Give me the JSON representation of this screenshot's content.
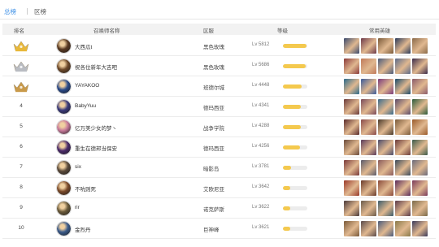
{
  "tabs": [
    {
      "label": "总榜",
      "active": true
    },
    {
      "label": "区榜",
      "active": false
    }
  ],
  "columns": {
    "rank": "排名",
    "name": "召唤师名称",
    "region": "区服",
    "level": "等级",
    "heroes": "常用英雄"
  },
  "colors": {
    "accent": "#3a8ee6",
    "level_bar": "#f4c94e",
    "gold_badge": "#e8b83a",
    "silver_badge": "#b9bcc2",
    "bronze_badge": "#c99a4a"
  },
  "rows": [
    {
      "rank": "1",
      "badge": "gold-crown",
      "name": "大西瓜t",
      "region": "黑色玫瑰",
      "level": "Lv 5812",
      "level_fill": 0.95,
      "avatar": "#5a3a22",
      "heroes": [
        "#3a4a6e",
        "#6e3a4a",
        "#7a5a3a",
        "#2a3a5a",
        "#8a6a4a"
      ]
    },
    {
      "rank": "2",
      "badge": "silver-crown",
      "name": "祝各位新年大吉吧",
      "region": "黑色玫瑰",
      "level": "Lv 5686",
      "level_fill": 0.92,
      "avatar": "#6e4a2a",
      "heroes": [
        "#8a3a3a",
        "#c07a5a",
        "#4a5a7a",
        "#5a6a8a",
        "#3a2a4a"
      ]
    },
    {
      "rank": "3",
      "badge": "bronze-crown",
      "name": "YAYAKOO",
      "region": "班德尔城",
      "level": "Lv 4448",
      "level_fill": 0.75,
      "avatar": "#2a4a8a",
      "heroes": [
        "#2a6a8a",
        "#3a5a9a",
        "#7a3a7a",
        "#1a4a6a",
        "#8a5a6a"
      ]
    },
    {
      "rank": "4",
      "badge": "",
      "name": "BabyYuu",
      "region": "德玛西亚",
      "level": "Lv 4341",
      "level_fill": 0.73,
      "avatar": "#3a3a7a",
      "heroes": [
        "#6a3a3a",
        "#7a4a5a",
        "#3a6a8a",
        "#5a4a6a",
        "#2a5a3a"
      ]
    },
    {
      "rank": "5",
      "badge": "",
      "name": "亿万美少女的梦丶",
      "region": "战争学院",
      "level": "Lv 4288",
      "level_fill": 0.72,
      "avatar": "#c77a9a",
      "heroes": [
        "#5a2a2a",
        "#8a4a4a",
        "#4a3a2a",
        "#7a5a3a",
        "#9a5a2a"
      ]
    },
    {
      "rank": "6",
      "badge": "",
      "name": "重生在德邦当保安",
      "region": "德玛西亚",
      "level": "Lv 4256",
      "level_fill": 0.71,
      "avatar": "#4a2a6a",
      "heroes": [
        "#6a4a3a",
        "#5a3a5a",
        "#4a4a6a",
        "#6a3a3a",
        "#3a5a4a"
      ]
    },
    {
      "rank": "7",
      "badge": "",
      "name": "six",
      "region": "暗影岛",
      "level": "Lv 3781",
      "level_fill": 0.34,
      "avatar": "#5a4a3a",
      "heroes": [
        "#7a3a3a",
        "#5a5a6a",
        "#8a5a5a",
        "#3a4a5a",
        "#6a6a7a"
      ]
    },
    {
      "rank": "8",
      "badge": "",
      "name": "不吭则死",
      "region": "艾欧尼亚",
      "level": "Lv 3642",
      "level_fill": 0.3,
      "avatar": "#7a4a2a",
      "heroes": [
        "#9a3a2a",
        "#6a3a2a",
        "#8a4a3a",
        "#5a2a5a",
        "#7a3a5a"
      ]
    },
    {
      "rank": "9",
      "badge": "",
      "name": "rir",
      "region": "诺克萨斯",
      "level": "Lv 3622",
      "level_fill": 0.3,
      "avatar": "#6a5a3a",
      "heroes": [
        "#4a3a3a",
        "#6a5a4a",
        "#3a5a6a",
        "#5a3a4a",
        "#7a6a4a"
      ]
    },
    {
      "rank": "10",
      "badge": "",
      "name": "金烈丹",
      "region": "巨神峰",
      "level": "Lv 3621",
      "level_fill": 0.3,
      "avatar": "#3a5a8a",
      "heroes": [
        "#7a5a3a",
        "#5a4a4a",
        "#4a5a7a",
        "#8a7a4a",
        "#3a3a5a"
      ]
    }
  ]
}
